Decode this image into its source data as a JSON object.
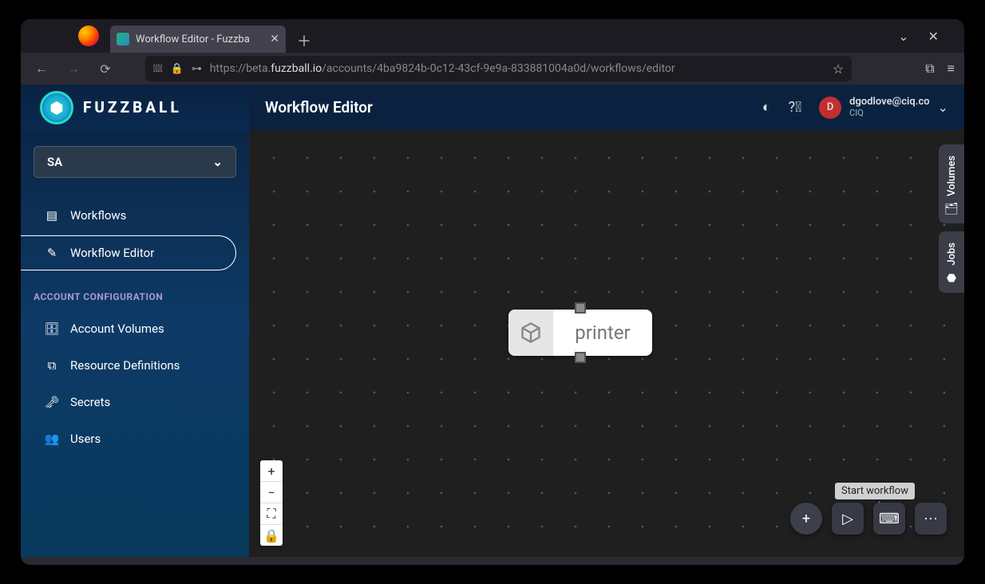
{
  "browser": {
    "tab_title": "Workflow Editor - Fuzzba",
    "url_prefix": "https://beta.",
    "url_host": "fuzzball.io",
    "url_path": "/accounts/4ba9824b-0c12-43cf-9e9a-833881004a0d/workflows/editor"
  },
  "header": {
    "brand": "FUZZBALL",
    "page_title": "Workflow Editor",
    "user_email": "dgodlove@ciq.co",
    "user_org": "CIQ",
    "avatar_initial": "D"
  },
  "sidebar": {
    "account_selector": "SA",
    "items": [
      {
        "label": "Workflows"
      },
      {
        "label": "Workflow Editor"
      }
    ],
    "section_label": "ACCOUNT CONFIGURATION",
    "config_items": [
      {
        "label": "Account Volumes"
      },
      {
        "label": "Resource Definitions"
      },
      {
        "label": "Secrets"
      },
      {
        "label": "Users"
      }
    ]
  },
  "canvas": {
    "node_label": "printer"
  },
  "right_rail": {
    "volumes": "Volumes",
    "jobs": "Jobs"
  },
  "tooltip": "Start workflow",
  "zoom": {
    "plus": "+",
    "minus": "−",
    "fit": "⛶",
    "lock": "🔒"
  },
  "fabs": {
    "add": "+",
    "play": "▷",
    "keyboard": "⌨",
    "more": "⋯"
  }
}
